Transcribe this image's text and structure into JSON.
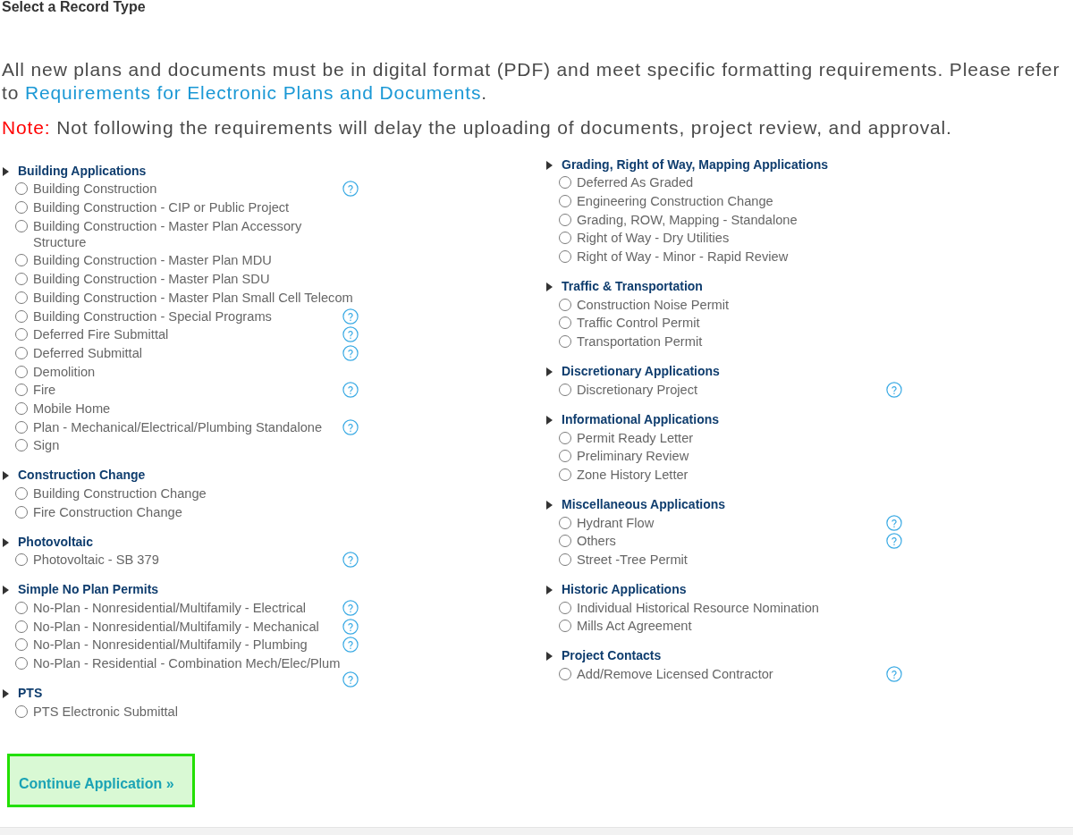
{
  "page": {
    "title": "Select a Record Type"
  },
  "notice": {
    "text": "All new plans and documents must be in digital format (PDF) and meet specific formatting requirements. Please refer to",
    "link": "Requirements for Electronic Plans and Documents",
    "text_after": "."
  },
  "note": {
    "label": "Note:",
    "text": "Not following the requirements will delay the uploading of documents, project review, and approval."
  },
  "columns": [
    {
      "groups": [
        {
          "title": "Building Applications",
          "items": [
            {
              "label": "Building Construction",
              "selected": false,
              "help": true
            },
            {
              "label": "Building Construction - CIP or Public Project",
              "selected": false,
              "help": false
            },
            {
              "label": "Building Construction - Master Plan Accessory Structure",
              "selected": false,
              "help": false
            },
            {
              "label": "Building Construction - Master Plan MDU",
              "selected": false,
              "help": false
            },
            {
              "label": "Building Construction - Master Plan SDU",
              "selected": false,
              "help": false
            },
            {
              "label": "Building Construction - Master Plan Small Cell Telecom",
              "selected": false,
              "help": false
            },
            {
              "label": "Building Construction - Special Programs",
              "selected": false,
              "help": true
            },
            {
              "label": "Deferred Fire Submittal",
              "selected": false,
              "help": true
            },
            {
              "label": "Deferred Submittal",
              "selected": false,
              "help": true
            },
            {
              "label": "Demolition",
              "selected": false,
              "help": false
            },
            {
              "label": "Fire",
              "selected": false,
              "help": true
            },
            {
              "label": "Mobile Home",
              "selected": false,
              "help": false
            },
            {
              "label": "Plan - Mechanical/Electrical/Plumbing Standalone",
              "selected": false,
              "help": true
            },
            {
              "label": "Sign",
              "selected": false,
              "help": false
            }
          ]
        },
        {
          "title": "Construction Change",
          "items": [
            {
              "label": "Building Construction Change",
              "selected": false,
              "help": false
            },
            {
              "label": "Fire Construction Change",
              "selected": false,
              "help": false
            }
          ]
        },
        {
          "title": "Photovoltaic",
          "items": [
            {
              "label": "Photovoltaic - SB 379",
              "selected": false,
              "help": true
            }
          ]
        },
        {
          "title": "Simple No Plan Permits",
          "items": [
            {
              "label": "No-Plan - Nonresidential/Multifamily - Electrical",
              "selected": false,
              "help": true
            },
            {
              "label": "No-Plan - Nonresidential/Multifamily - Mechanical",
              "selected": false,
              "help": true
            },
            {
              "label": "No-Plan - Nonresidential/Multifamily - Plumbing",
              "selected": false,
              "help": true
            },
            {
              "label": "No-Plan - Residential - Combination Mech/Elec/Plum",
              "selected": false,
              "help": true
            }
          ]
        },
        {
          "title": "PTS",
          "items": [
            {
              "label": "PTS Electronic Submittal",
              "selected": false,
              "help": false
            }
          ]
        }
      ]
    },
    {
      "groups": [
        {
          "title": "Grading, Right of Way, Mapping Applications",
          "items": [
            {
              "label": "Deferred As Graded",
              "selected": false,
              "help": false
            },
            {
              "label": "Engineering Construction Change",
              "selected": false,
              "help": false
            },
            {
              "label": "Grading, ROW, Mapping - Standalone",
              "selected": false,
              "help": false
            },
            {
              "label": "Right of Way - Dry Utilities",
              "selected": false,
              "help": false
            },
            {
              "label": "Right of Way - Minor - Rapid Review",
              "selected": false,
              "help": false
            }
          ]
        },
        {
          "title": "Traffic & Transportation",
          "items": [
            {
              "label": "Construction Noise Permit",
              "selected": false,
              "help": false
            },
            {
              "label": "Traffic Control Permit",
              "selected": false,
              "help": false
            },
            {
              "label": "Transportation Permit",
              "selected": false,
              "help": false
            }
          ]
        },
        {
          "title": "Discretionary Applications",
          "items": [
            {
              "label": "Discretionary Project",
              "selected": false,
              "help": true
            }
          ]
        },
        {
          "title": "Informational Applications",
          "items": [
            {
              "label": "Permit Ready Letter",
              "selected": false,
              "help": false
            },
            {
              "label": "Preliminary Review",
              "selected": false,
              "help": false
            },
            {
              "label": "Zone History Letter",
              "selected": false,
              "help": false
            }
          ]
        },
        {
          "title": "Miscellaneous Applications",
          "items": [
            {
              "label": "Hydrant Flow",
              "selected": false,
              "help": true
            },
            {
              "label": "Others",
              "selected": false,
              "help": true
            },
            {
              "label": "Street -Tree Permit",
              "selected": false,
              "help": false
            }
          ]
        },
        {
          "title": "Historic Applications",
          "items": [
            {
              "label": "Individual Historical Resource Nomination",
              "selected": false,
              "help": false
            },
            {
              "label": "Mills Act Agreement",
              "selected": false,
              "help": false
            }
          ]
        },
        {
          "title": "Project Contacts",
          "items": [
            {
              "label": "Add/Remove Licensed Contractor",
              "selected": false,
              "help": true
            }
          ]
        }
      ]
    }
  ],
  "continue_button": {
    "label": "Continue Application »"
  }
}
